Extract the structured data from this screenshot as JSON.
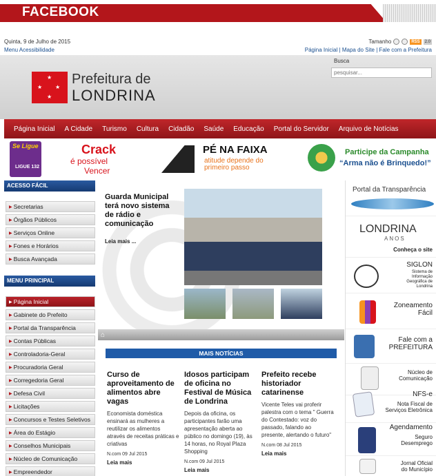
{
  "fb": {
    "title": "FACEBOOK"
  },
  "top": {
    "date": "Quinta, 9 de Julho de 2015",
    "acess": "Menu Acessibilidade",
    "tamanho": "Tamanho",
    "links": "Página Inicial | Mapa do Site | Fale com a Prefeitura"
  },
  "header": {
    "t1": "Prefeitura de",
    "t2": "LONDRINA",
    "busca": "Busca",
    "busca_ph": "pesquisar..."
  },
  "nav": [
    "Página Inicial",
    "A Cidade",
    "Turismo",
    "Cultura",
    "Cidadão",
    "Saúde",
    "Educação",
    "Portal do Servidor",
    "Arquivo de Notícias"
  ],
  "banners": {
    "ligue": "Se Ligue",
    "ligue_num": "LIGUE 132",
    "crack1": "Crack",
    "crack2": "é possível",
    "crack3": "Vencer",
    "pe1": "PÉ NA FAIXA",
    "pe2": "atitude depende do",
    "pe3": "primeiro passo",
    "arma1": "Participe da Campanha",
    "arma2": "“Arma não é Brinquedo!”"
  },
  "acesso": {
    "title": "ACESSO FÁCIL",
    "items": [
      "Secretarias",
      "Órgãos Públicos",
      "Serviços Online",
      "Fones e Horários",
      "Busca Avançada"
    ]
  },
  "menu": {
    "title": "MENU PRINCIPAL",
    "items": [
      "Página Inicial",
      "Gabinete do Prefeito",
      "Portal da Transparência",
      "Contas Públicas",
      "Controladoria-Geral",
      "Procuradoria Geral",
      "Corregedoria Geral",
      "Defesa Civil",
      "Licitações",
      "Concursos e Testes Seletivos",
      "Área do Estágio",
      "Conselhos Municipais",
      "Núcleo de Comunicação",
      "Empreendedor"
    ]
  },
  "feature": {
    "title": "Guarda Municipal terá novo sistema de rádio e comunicação",
    "leia": "Leia mais ..."
  },
  "mais": "MAIS NOTÍCIAS",
  "news": [
    {
      "title": "Curso de aproveitamento de alimentos abre vagas",
      "desc": "Economista doméstica ensinará as mulheres a reutilizar os alimentos através de receitas práticas e criativas",
      "meta": "N.com 09 Jul 2015",
      "leia": "Leia mais"
    },
    {
      "title": "Idosos participam de oficina no Festival de Música de Londrina",
      "desc": "Depois da oficina, os participantes farão uma apresentação aberta ao público no domingo (19), às 14 horas, no Royal Plaza Shopping",
      "meta": "N.com 09 Jul 2015",
      "leia": "Leia mais"
    },
    {
      "title": "Prefeito recebe historiador catarinense",
      "desc": "Vicente Teles vai proferir palestra com o tema \" Guerra do Contestado: voz do passado, falando ao presente, alertando o futuro\"",
      "meta": "N.com 08 Jul 2015",
      "leia": "Leia mais"
    }
  ],
  "right": {
    "portal": "Portal da Transparência",
    "londrina": "LONDRINA",
    "anos": "ANOS",
    "conheca": "Conheça o site",
    "siglon": "SIGLON",
    "siglon2": "Sistema de Informação Geográfica de Londrina",
    "zon1": "Zoneamento",
    "zon2": "Fácil",
    "fale1": "Fale com a",
    "fale2": "PREFEITURA",
    "nuc1": "Núcleo de",
    "nuc2": "Comunicação",
    "nfs1": "NFS-e",
    "nfs2": "Nota Fiscal de Serviços Eletrônica",
    "ag1": "Agendamento",
    "ag2": "Seguro",
    "ag3": "Desemprego",
    "jor1": "Jornal Oficial",
    "jor2": "do Município"
  }
}
